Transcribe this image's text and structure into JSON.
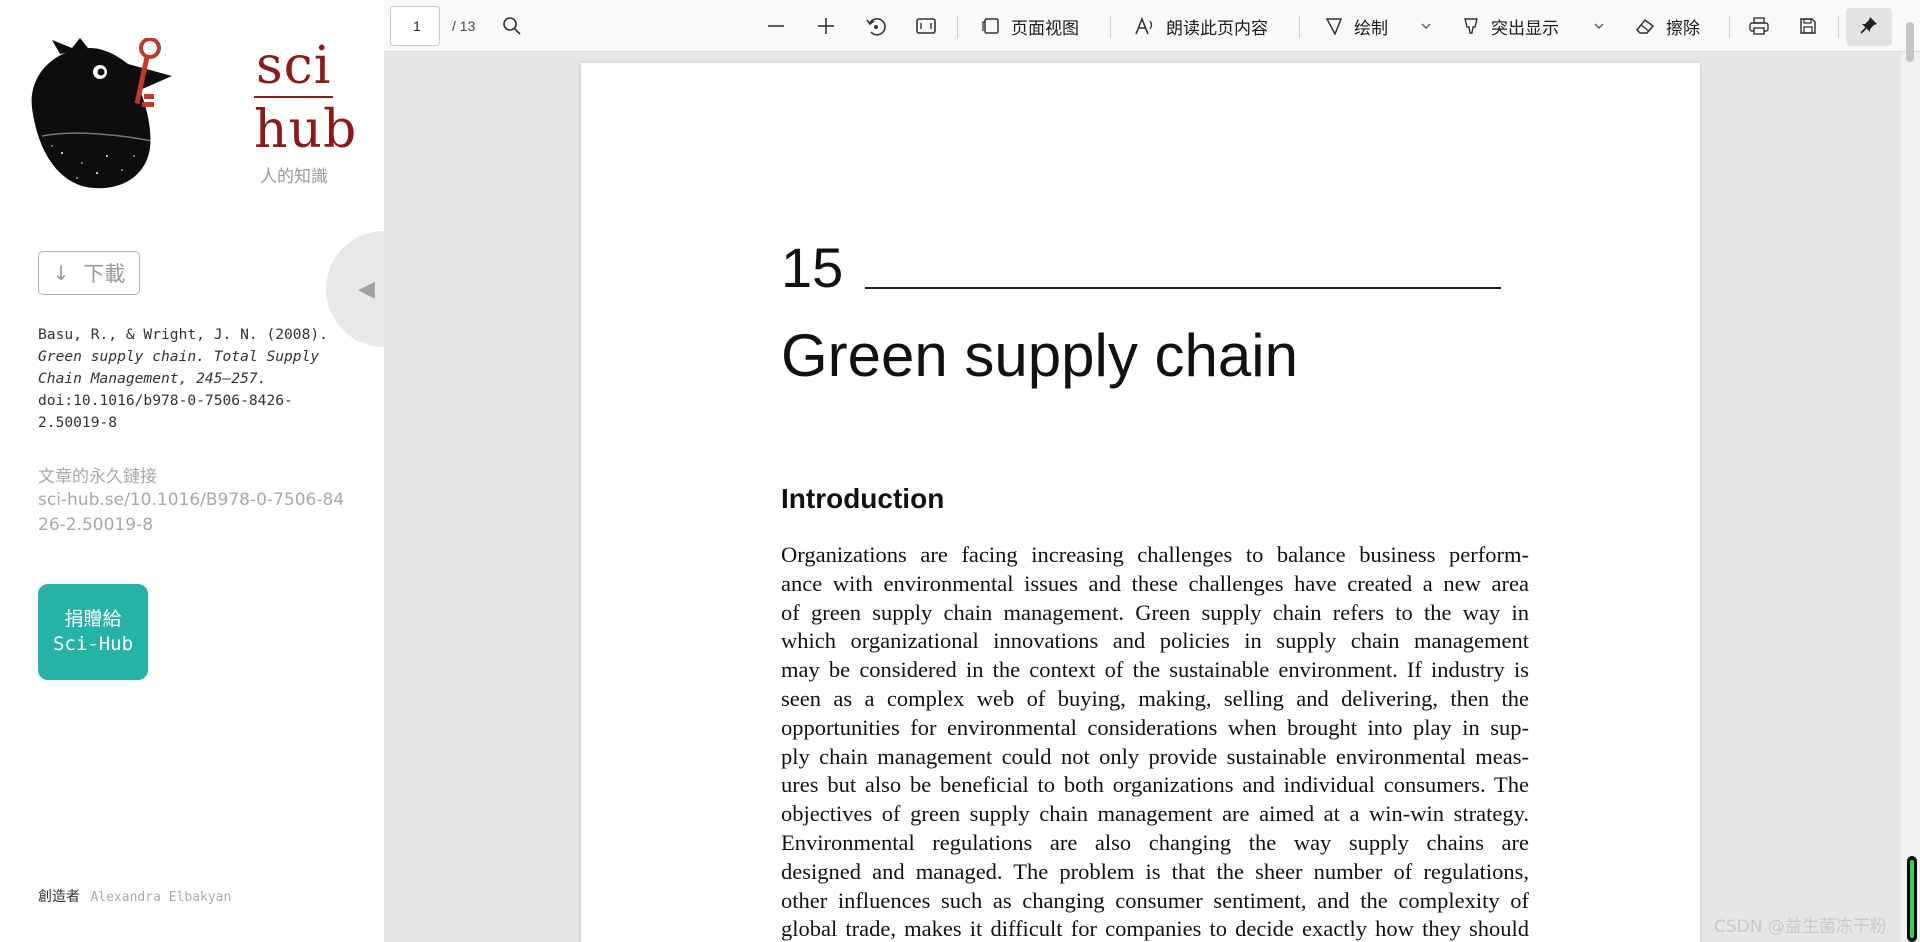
{
  "sidebar": {
    "logo": {
      "line1": "sci",
      "line2": "hub",
      "subtitle": "人的知識"
    },
    "download_label": "下載",
    "download_icon": "arrow-down-icon",
    "citation": {
      "authors": "Basu, R., & Wright, J. N.",
      "year": "(2008).",
      "title": "Green supply chain.",
      "source": "Total Supply Chain Management, 245–257.",
      "doi": "doi:10.1016/b978-0-7506-8426-2.50019-8"
    },
    "permalink_label": "文章的永久鏈接",
    "permalink": "sci-hub.se/10.1016/B978-0-7506-8426-2.50019-8",
    "donate_line1": "捐贈給",
    "donate_line2": "Sci-Hub",
    "donate_color": "#24b3a6",
    "creator_label": "創造者",
    "creator_name": "Alexandra Elbakyan"
  },
  "toolbar": {
    "page_value": "1",
    "page_total": "/ 13",
    "page_view_label": "页面视图",
    "read_aloud_label": "朗读此页内容",
    "draw_label": "绘制",
    "highlight_label": "突出显示",
    "erase_label": "擦除"
  },
  "document": {
    "chapter_number": "15",
    "chapter_title": "Green supply chain",
    "section_heading": "Introduction",
    "body_lines": [
      "Organizations are facing increasing challenges to balance business perform-",
      "ance with environmental issues and these challenges have created a new area",
      "of green supply chain management. Green supply chain refers to the way in",
      "which organizational innovations and policies in supply chain management",
      "may be considered in the context of the sustainable environment. If industry is",
      "seen as a complex web of buying, making, selling and delivering, then the",
      "opportunities for environmental considerations when brought into play in sup-",
      "ply chain management could not only provide sustainable environmental meas-",
      "ures but also be beneficial to both organizations and individual consumers. The",
      "objectives of green supply chain management are aimed at a win-win strategy.",
      "Environmental regulations are also changing the way supply chains are",
      "designed and managed. The problem is that the sheer number of regulations,",
      "other influences such as changing consumer sentiment, and the complexity of",
      "global trade, makes it difficult for companies to decide exactly how they should"
    ]
  },
  "watermark": "CSDN @益生菌冻干粉"
}
